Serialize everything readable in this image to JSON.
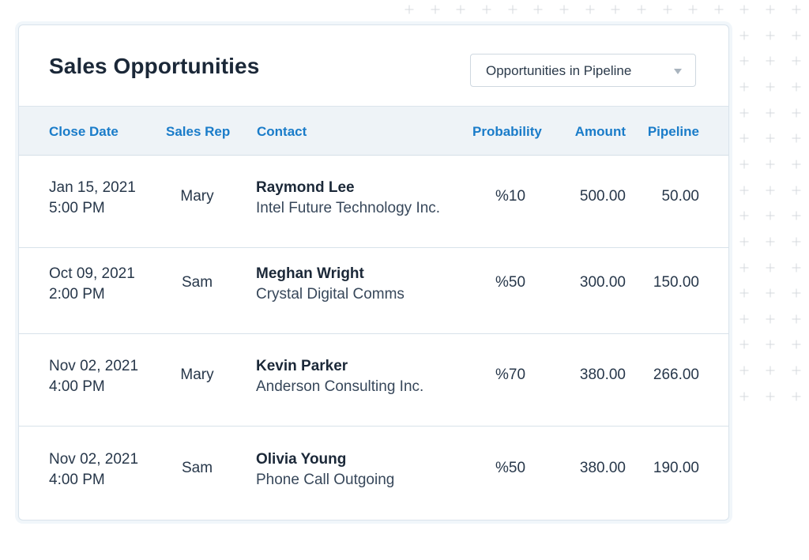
{
  "card": {
    "title": "Sales Opportunities",
    "filter": {
      "selected": "Opportunities in Pipeline",
      "icon": "chevron-down-icon"
    }
  },
  "table": {
    "columns": [
      "Close Date",
      "Sales Rep",
      "Contact",
      "Probability",
      "Amount",
      "Pipeline"
    ],
    "rows": [
      {
        "date": "Jan 15, 2021",
        "time": "5:00 PM",
        "rep": "Mary",
        "contact_name": "Raymond Lee",
        "contact_company": "Intel Future Technology Inc.",
        "probability": "%10",
        "amount": "500.00",
        "pipeline": "50.00"
      },
      {
        "date": "Oct 09, 2021",
        "time": "2:00 PM",
        "rep": "Sam",
        "contact_name": "Meghan Wright",
        "contact_company": "Crystal Digital Comms",
        "probability": "%50",
        "amount": "300.00",
        "pipeline": "150.00"
      },
      {
        "date": "Nov 02, 2021",
        "time": "4:00 PM",
        "rep": "Mary",
        "contact_name": "Kevin Parker",
        "contact_company": "Anderson Consulting Inc.",
        "probability": "%70",
        "amount": "380.00",
        "pipeline": "266.00"
      },
      {
        "date": "Nov 02, 2021",
        "time": "4:00 PM",
        "rep": "Sam",
        "contact_name": "Olivia Young",
        "contact_company": "Phone Call Outgoing",
        "probability": "%50",
        "amount": "380.00",
        "pipeline": "190.00"
      }
    ]
  },
  "colors": {
    "accent": "#1a7cc9",
    "header_bg": "#eef3f7",
    "text_dark": "#1b2838",
    "border": "#d9e3ec"
  }
}
